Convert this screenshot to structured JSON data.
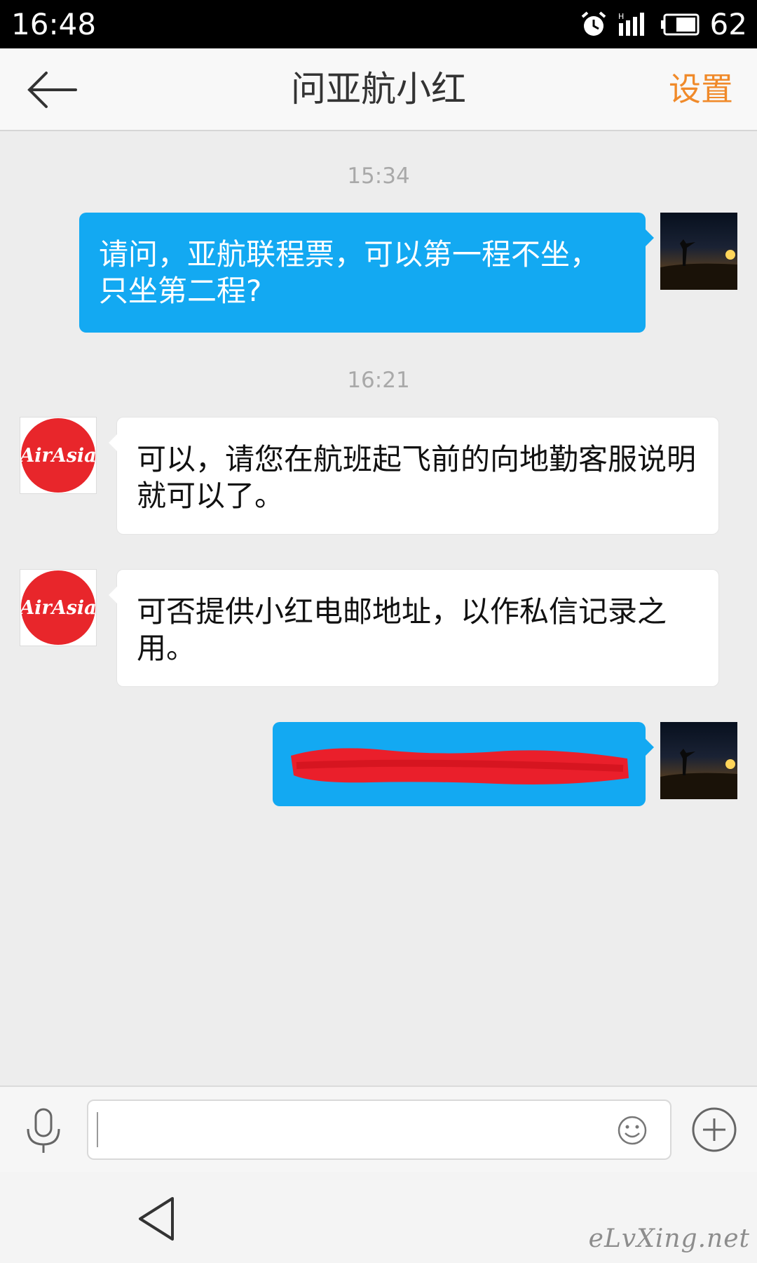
{
  "status_bar": {
    "time": "16:48",
    "battery": "62",
    "icons": [
      "alarm-icon",
      "signal-icon",
      "battery-icon"
    ]
  },
  "header": {
    "title": "问亚航小红",
    "settings_label": "设置",
    "back_icon": "arrow-left-icon"
  },
  "messages": [
    {
      "type": "timestamp",
      "text": "15:34"
    },
    {
      "type": "outgoing",
      "text": "请问，亚航联程票，可以第一程不坐，只坐第二程?"
    },
    {
      "type": "timestamp",
      "text": "16:21"
    },
    {
      "type": "incoming",
      "sender": "AirAsia",
      "text": "可以，请您在航班起飞前的向地勤客服说明就可以了。"
    },
    {
      "type": "incoming",
      "sender": "AirAsia",
      "text": "可否提供小红电邮地址，以作私信记录之用。"
    },
    {
      "type": "outgoing",
      "text": "",
      "redacted": true
    }
  ],
  "input_bar": {
    "value": "",
    "icons": [
      "microphone-icon",
      "emoji-icon",
      "plus-icon"
    ]
  },
  "nav_bar": {
    "icons": [
      "nav-back-icon"
    ]
  },
  "watermark": "eLvXing.net",
  "colors": {
    "accent": "#f08a2a",
    "outgoing_bubble": "#13a9f2",
    "background": "#ededed",
    "airasia_red": "#e8262b",
    "redaction": "#ea1f2b"
  }
}
